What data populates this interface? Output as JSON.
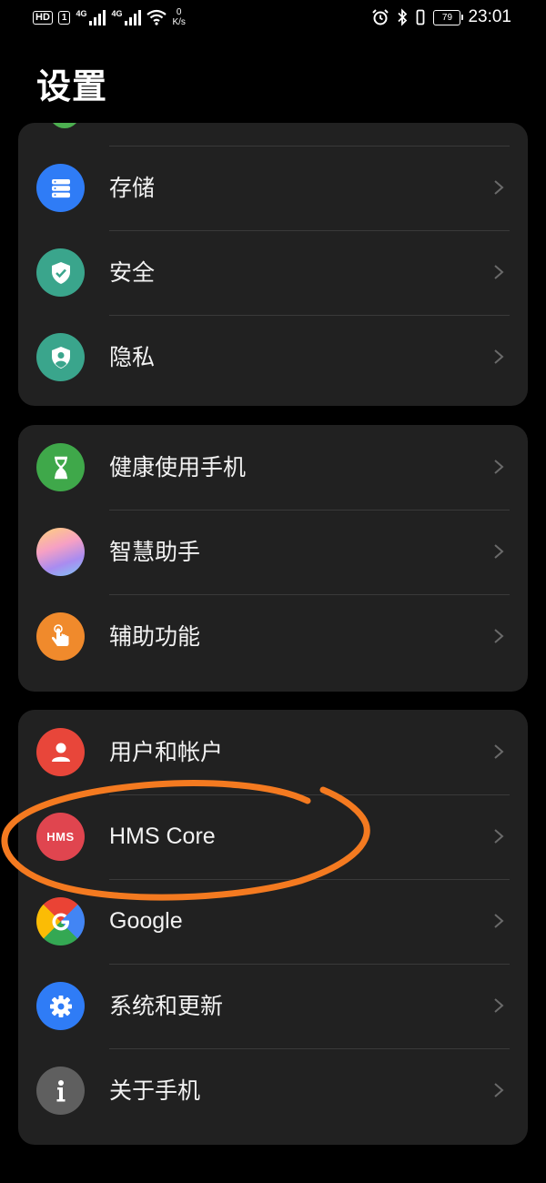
{
  "status_bar": {
    "hd": "HD",
    "sim1": "1",
    "sig1_label": "4G",
    "sig2_label": "4G",
    "speed_value": "0",
    "speed_unit": "K/s",
    "battery": "79",
    "time": "23:01"
  },
  "page": {
    "title": "设置"
  },
  "groups": [
    {
      "items": [
        {
          "label": "存储",
          "icon": "storage-icon",
          "color": "#2f7cf6"
        },
        {
          "label": "安全",
          "icon": "security-shield-icon",
          "color": "#3aa58c"
        },
        {
          "label": "隐私",
          "icon": "privacy-icon",
          "color": "#3aa58c"
        }
      ]
    },
    {
      "items": [
        {
          "label": "健康使用手机",
          "icon": "hourglass-icon",
          "color": "#3fa84a"
        },
        {
          "label": "智慧助手",
          "icon": "smart-assistant-icon",
          "color": "#f0a3c8"
        },
        {
          "label": "辅助功能",
          "icon": "accessibility-hand-icon",
          "color": "#f08a2c"
        }
      ]
    },
    {
      "items": [
        {
          "label": "用户和帐户",
          "icon": "user-account-icon",
          "color": "#e8463a"
        },
        {
          "label": "HMS Core",
          "icon": "hms-core-icon",
          "icon_text": "HMS",
          "color": "#e0454f"
        },
        {
          "label": "Google",
          "icon": "google-icon",
          "color": "#ffffff"
        },
        {
          "label": "系统和更新",
          "icon": "system-update-gear-icon",
          "color": "#2f7cf6"
        },
        {
          "label": "关于手机",
          "icon": "about-phone-info-icon",
          "color": "#5f5f5f"
        }
      ]
    }
  ],
  "annotation_color": "#f47a20"
}
